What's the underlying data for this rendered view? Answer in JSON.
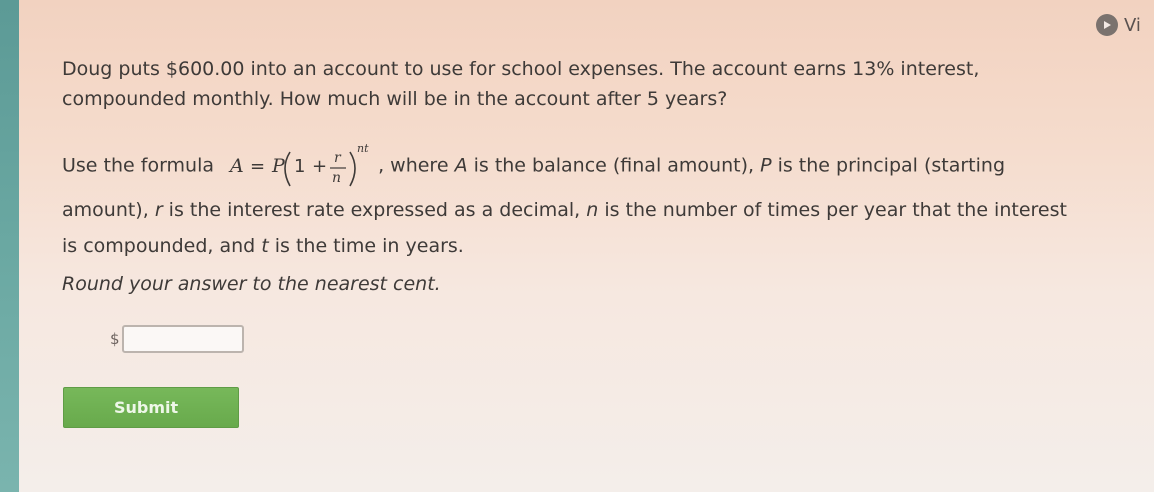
{
  "header": {
    "video_label": "Vi",
    "video_icon": "play-icon"
  },
  "question": {
    "text": "Doug puts $600.00 into an account to use for school expenses. The account earns 13% interest, compounded monthly. How much will be in the account after 5 years?"
  },
  "formula_paragraph": {
    "lead": "Use the formula",
    "formula": {
      "A": "A",
      "equals": "=",
      "P": "P",
      "one": "1",
      "plus": "+",
      "r": "r",
      "n": "n",
      "exponent": "nt"
    },
    "after_formula": ", where ",
    "A_var": "A",
    "desc_A": " is the balance (final amount), ",
    "P_var": "P",
    "desc_P": " is the principal (starting amount), ",
    "r_var": "r",
    "desc_r": " is the interest rate expressed as a decimal, ",
    "n_var": "n",
    "desc_n": " is the number of times per year that the interest is compounded, and ",
    "t_var": "t",
    "desc_t": " is the time in years."
  },
  "instructions": {
    "round_note": "Round your answer to the nearest cent."
  },
  "answer": {
    "currency_symbol": "$",
    "value": "",
    "placeholder": ""
  },
  "actions": {
    "submit_label": "Submit"
  },
  "colors": {
    "submit_bg": "#6aad4e",
    "accent_strip": "#6aa8a2"
  }
}
